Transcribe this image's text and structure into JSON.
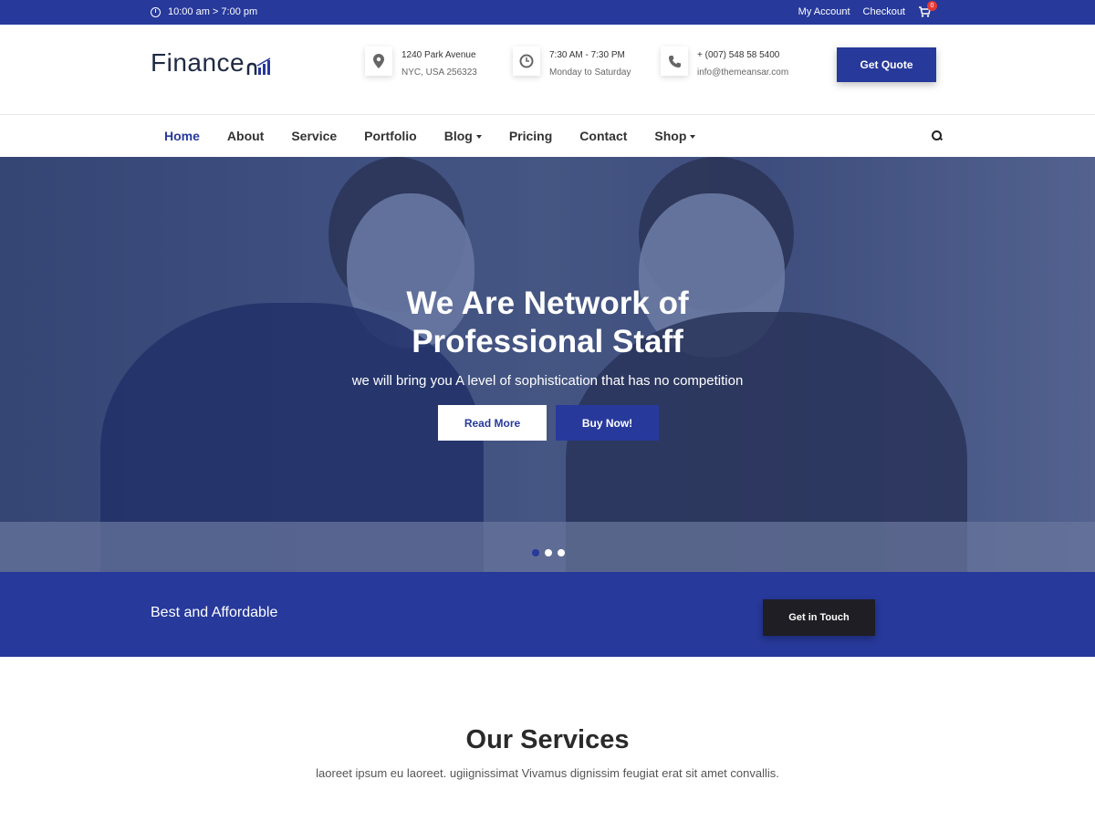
{
  "topbar": {
    "hours": "10:00 am > 7:00 pm",
    "my_account": "My Account",
    "checkout": "Checkout",
    "cart_count": "0"
  },
  "header": {
    "logo_text": "Finance",
    "address_line1": "1240 Park Avenue",
    "address_line2": "NYC, USA 256323",
    "time_line1": "7:30 AM - 7:30 PM",
    "time_line2": "Monday to Saturday",
    "phone": "+ (007) 548 58 5400",
    "email": "info@themeansar.com",
    "quote_label": "Get Quote"
  },
  "nav": {
    "items": [
      {
        "label": "Home"
      },
      {
        "label": "About"
      },
      {
        "label": "Service"
      },
      {
        "label": "Portfolio"
      },
      {
        "label": "Blog"
      },
      {
        "label": "Pricing"
      },
      {
        "label": "Contact"
      },
      {
        "label": "Shop"
      }
    ]
  },
  "hero": {
    "title_line1": "We Are Network of",
    "title_line2": "Professional Staff",
    "subtitle": "we will bring you A level of sophistication that has no competition",
    "read_more": "Read More",
    "buy_now": "Buy Now!"
  },
  "cta": {
    "text": "Best and Affordable",
    "button": "Get in Touch"
  },
  "services": {
    "title": "Our Services",
    "subtitle": "laoreet ipsum eu laoreet. ugiignissimat Vivamus dignissim feugiat erat sit amet convallis."
  },
  "colors": {
    "primary": "#27399b",
    "dark_button": "#1e1e24"
  }
}
